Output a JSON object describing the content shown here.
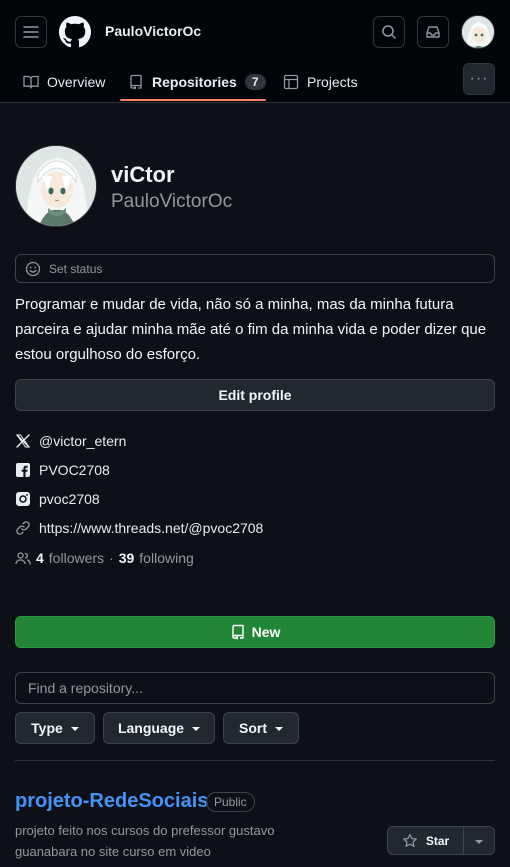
{
  "header": {
    "username": "PauloVictorOc",
    "menu_icon": "hamburger-icon",
    "search_icon": "search-icon",
    "inbox_icon": "inbox-icon"
  },
  "tabs": [
    {
      "label": "Overview",
      "icon": "book-icon"
    },
    {
      "label": "Repositories",
      "icon": "repo-icon",
      "count": "7",
      "selected": true
    },
    {
      "label": "Projects",
      "icon": "table-icon"
    }
  ],
  "profile": {
    "name": "viCtor",
    "login": "PauloVictorOc",
    "status_label": "Set status",
    "bio": "Programar e mudar de vida, não só a minha, mas da minha futura parceira e ajudar minha mãe até o fim da minha vida e poder dizer que estou orgulhoso do esforço.",
    "edit_label": "Edit profile",
    "social": {
      "x": "@victor_etern",
      "facebook": "PVOC2708",
      "instagram": "pvoc2708",
      "link": "https://www.threads.net/@pvoc2708"
    },
    "followers_count": "4",
    "followers_label": "followers",
    "separator": "·",
    "following_count": "39",
    "following_label": "following"
  },
  "repos": {
    "new_label": "New",
    "search_placeholder": "Find a repository...",
    "filters": {
      "type": "Type",
      "language": "Language",
      "sort": "Sort"
    },
    "items": [
      {
        "name": "projeto-RedeSociais",
        "visibility": "Public",
        "description": "projeto feito nos cursos do prefessor gustavo guanabara no site curso em video",
        "star_label": "Star"
      }
    ]
  },
  "colors": {
    "background": "#0d1117",
    "header": "#010409",
    "accent_underline": "#f78166",
    "new_button": "#238636",
    "link": "#4493f8"
  }
}
